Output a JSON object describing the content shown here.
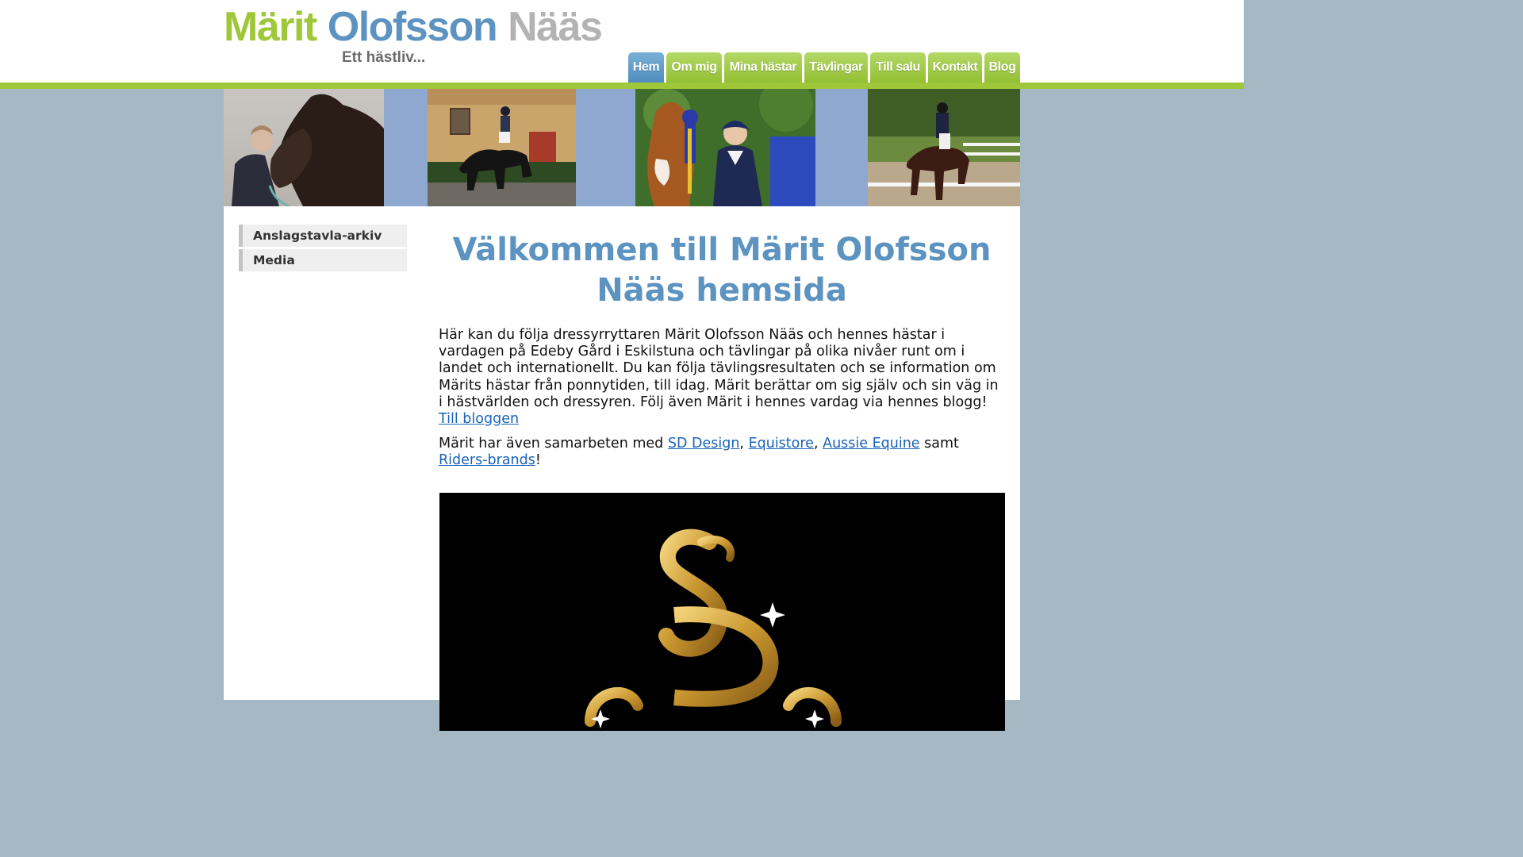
{
  "header": {
    "logo": {
      "first": "Märit",
      "middle": "Olofsson",
      "last": "Nääs",
      "tagline": "Ett hästliv..."
    },
    "nav": [
      {
        "label": "Hem",
        "active": true
      },
      {
        "label": "Om mig"
      },
      {
        "label": "Mina hästar"
      },
      {
        "label": "Tävlingar"
      },
      {
        "label": "Till salu"
      },
      {
        "label": "Kontakt"
      },
      {
        "label": "Blog"
      }
    ]
  },
  "sidebar": {
    "items": [
      {
        "label": "Anslagstavla-arkiv"
      },
      {
        "label": "Media"
      }
    ]
  },
  "main": {
    "title_line1": "Välkommen till Märit Olofsson",
    "title_line2": "Nääs hemsida",
    "intro_text": "Här kan du följa dressyrryttaren Märit Olofsson Nääs och hennes hästar i vardagen på Edeby Gård i Eskilstuna och tävlingar på olika nivåer runt om i landet och internationellt. Du kan följa tävlingsresultaten och se information om Märits hästar från ponnytiden, till idag. Märit berättar om sig själv och sin väg in i hästvärlden och dressyren. Följ även Märit i hennes vardag via hennes blogg!",
    "blog_link": "Till bloggen",
    "partners_prefix": "Märit har även samarbeten med",
    "partner1": "SD Design",
    "partner2": "Equistore",
    "partner3": "Aussie Equine",
    "partners_and": "samt",
    "partner4": "Riders-brands",
    "partners_end": "!"
  },
  "colors": {
    "brand_green": "#9fc73a",
    "brand_blue": "#5c93c0",
    "logo_gray": "#b3b3b3",
    "page_background": "#a6b8c4",
    "banner_blue": "#8fa8cf",
    "link": "#1a63b8",
    "sd_gold": "#d4a437"
  }
}
